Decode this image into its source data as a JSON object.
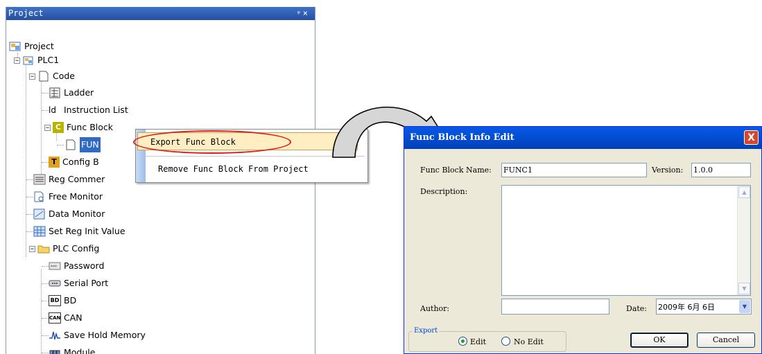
{
  "panel": {
    "title": "Project",
    "pin": "ᵠ",
    "close": "×"
  },
  "tree": {
    "project": "Project",
    "plc1": "PLC1",
    "code": "Code",
    "ladder": "Ladder",
    "instruction_list": "Instruction List",
    "func_block": "Func Block",
    "fun1": "FUN",
    "config_b": "Config B",
    "reg_comment": "Reg Commer",
    "free_monitor": "Free Monitor",
    "data_monitor": "Data Monitor",
    "set_reg_init": "Set Reg Init Value",
    "plc_config": "PLC Config",
    "password": "Password",
    "serial_port": "Serial Port",
    "bd": "BD",
    "can": "CAN",
    "save_hold": "Save Hold Memory",
    "module": "Module",
    "icon_text": {
      "instruction": "ld",
      "func": "C",
      "config": "T",
      "bd": "BD",
      "can": "CAN"
    }
  },
  "context_menu": {
    "export": "Export Func Block",
    "remove": "Remove Func Block From Project"
  },
  "dialog": {
    "title": "Func Block Info Edit",
    "close": "X",
    "name_label": "Func Block Name:",
    "name_value": "FUNC1",
    "version_label": "Version:",
    "version_value": "1.0.0",
    "description_label": "Description:",
    "author_label": "Author:",
    "author_value": "",
    "date_label": "Date:",
    "date_value": "2009年 6月 6日",
    "export_legend": "Export",
    "edit_label": "Edit",
    "no_edit_label": "No Edit",
    "ok": "OK",
    "cancel": "Cancel",
    "scroll_up": "▲",
    "scroll_down": "▼",
    "dropdown": "▼"
  },
  "colors": {
    "titlebar": "#0450d6",
    "highlight": "#e01a1a",
    "menu_hover": "#ffeec2"
  }
}
